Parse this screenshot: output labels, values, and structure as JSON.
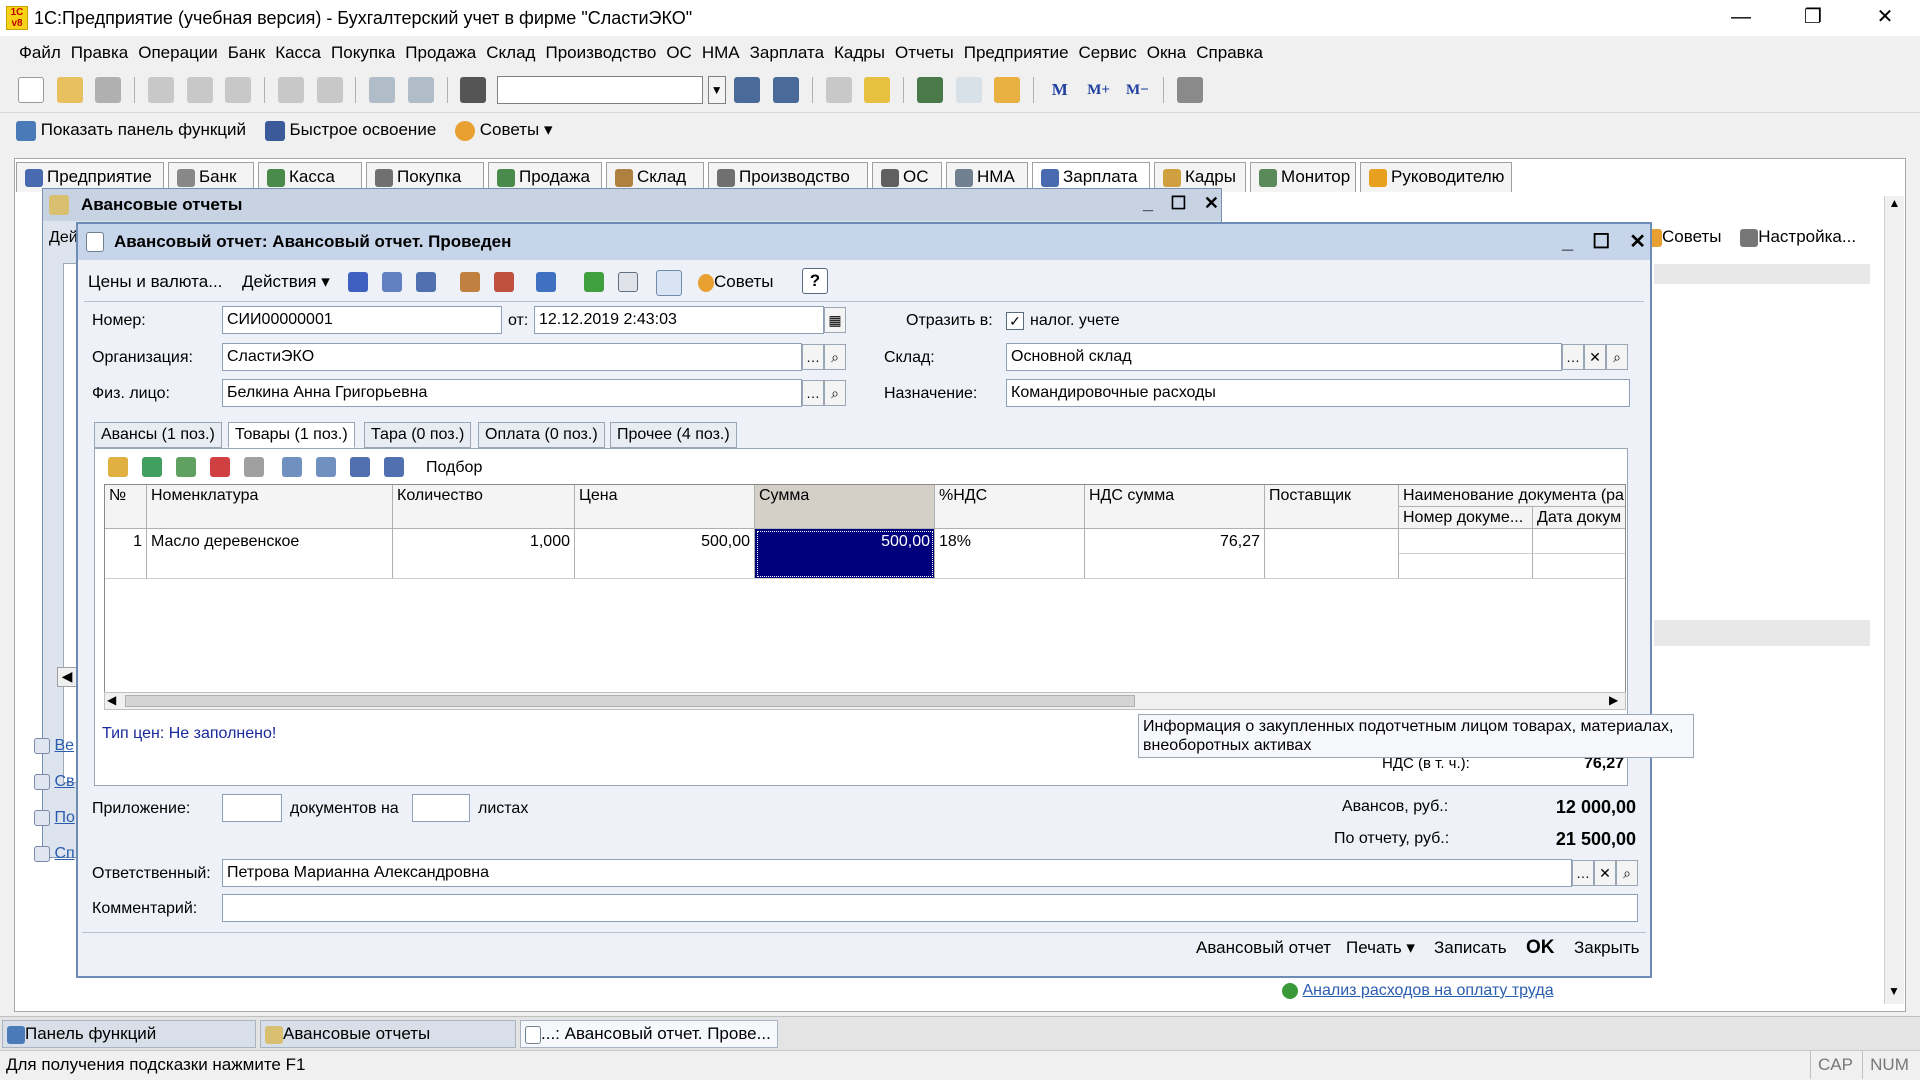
{
  "window": {
    "title": "1С:Предприятие (учебная версия) - Бухгалтерский учет в фирме \"СластиЭКО\"",
    "logo": "1С v8"
  },
  "menu": [
    "Файл",
    "Правка",
    "Операции",
    "Банк",
    "Касса",
    "Покупка",
    "Продажа",
    "Склад",
    "Производство",
    "ОС",
    "НМА",
    "Зарплата",
    "Кадры",
    "Отчеты",
    "Предприятие",
    "Сервис",
    "Окна",
    "Справка"
  ],
  "toolbar2": {
    "show_panel": "Показать панель функций",
    "quick": "Быстрое освоение",
    "tips": "Советы"
  },
  "tabs": [
    "Предприятие",
    "Банк",
    "Касса",
    "Покупка",
    "Продажа",
    "Склад",
    "Производство",
    "ОС",
    "НМА",
    "Зарплата",
    "Кадры",
    "Монитор",
    "Руководителю"
  ],
  "right_panel": {
    "tips": "Советы",
    "settings": "Настройка..."
  },
  "bg_window": {
    "title": "Авансовые отчеты",
    "tab_fragment": "Дей"
  },
  "dialog": {
    "title": "Авансовый отчет: Авансовый отчет. Проведен",
    "toolbar": {
      "prices": "Цены и валюта...",
      "actions": "Действия",
      "tips": "Советы",
      "help": "?"
    },
    "number_label": "Номер:",
    "number": "СИИ00000001",
    "date_label": "от:",
    "date": "12.12.2019  2:43:03",
    "reflect_label": "Отразить в:",
    "reflect_checked": true,
    "reflect_value": "налог. учете",
    "org_label": "Организация:",
    "org": "СластиЭКО",
    "warehouse_label": "Склад:",
    "warehouse": "Основной склад",
    "person_label": "Физ. лицо:",
    "person": "Белкина Анна Григорьевна",
    "purpose_label": "Назначение:",
    "purpose": "Командировочные расходы",
    "inner_tabs": [
      "Авансы (1 поз.)",
      "Товары (1 поз.)",
      "Тара (0 поз.)",
      "Оплата (0 поз.)",
      "Прочее (4 поз.)"
    ],
    "pick": "Подбор",
    "grid": {
      "headers": [
        "№",
        "Номенклатура",
        "Количество",
        "Цена",
        "Сумма",
        "%НДС",
        "НДС сумма",
        "Поставщик",
        "Наименование документа (ра"
      ],
      "subheaders": [
        "Номер докуме...",
        "Дата докум"
      ],
      "rows": [
        {
          "n": "1",
          "item": "Масло деревенское",
          "qty": "1,000",
          "price": "500,00",
          "sum": "500,00",
          "vat_rate": "18%",
          "vat_sum": "76,27",
          "supplier": ""
        }
      ]
    },
    "price_type": "Тип цен: Не заполнено!",
    "tooltip": "Информация о закупленных подотчетным лицом товарах, материалах, внеоборотных активах",
    "vat_label": "НДС (в т. ч.):",
    "vat_value": "76,27",
    "attach_label": "Приложение:",
    "attach_docs": "документов на",
    "attach_sheets": "листах",
    "advances_label": "Авансов, руб.:",
    "advances_value": "12 000,00",
    "report_label": "По отчету, руб.:",
    "report_value": "21 500,00",
    "resp_label": "Ответственный:",
    "resp": "Петрова Марианна Александровна",
    "comment_label": "Комментарий:",
    "comment": "",
    "footer": {
      "report": "Авансовый отчет",
      "print": "Печать",
      "save": "Записать",
      "ok": "OK",
      "close": "Закрыть"
    }
  },
  "left_links": [
    "Ве",
    "Св",
    "По",
    "Сп"
  ],
  "bottom_link": "Анализ расходов на оплату труда",
  "taskbar": [
    "Панель функций",
    "Авансовые отчеты",
    "...: Авансовый отчет. Прове..."
  ],
  "status": {
    "hint": "Для получения подсказки нажмите F1",
    "cap": "CAP",
    "num": "NUM"
  },
  "colors": {
    "accent": "#00007d",
    "dialog_header": "#c6d5ea",
    "link": "#2a5cb0"
  }
}
